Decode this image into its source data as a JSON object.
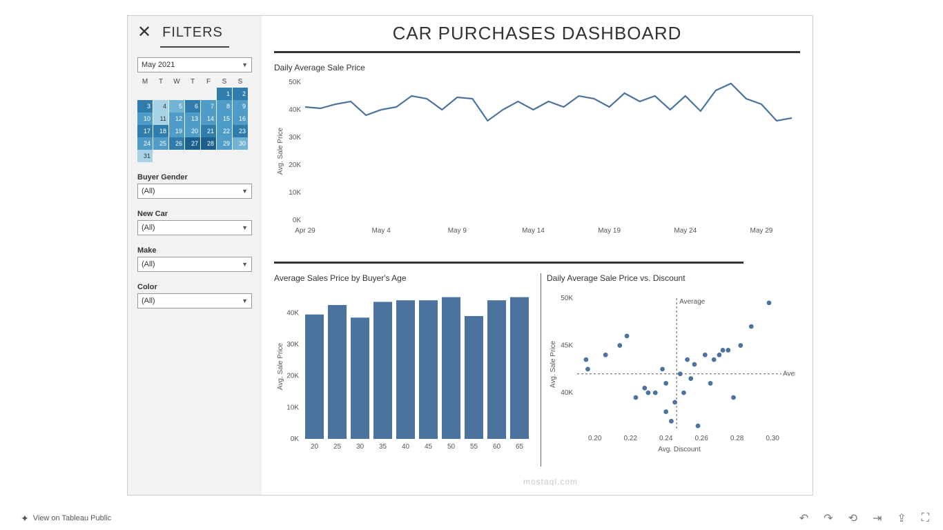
{
  "filters": {
    "title": "FILTERS",
    "month_dropdown": "May 2021",
    "weekdays": [
      "M",
      "T",
      "W",
      "T",
      "F",
      "S",
      "S"
    ],
    "calendar_rows": [
      [
        null,
        null,
        null,
        null,
        null,
        {
          "d": 1,
          "c": 4
        },
        {
          "d": 2,
          "c": 4
        }
      ],
      [
        {
          "d": 3,
          "c": 4
        },
        {
          "d": 4,
          "c": 1
        },
        {
          "d": 5,
          "c": 2
        },
        {
          "d": 6,
          "c": 4
        },
        {
          "d": 7,
          "c": 3
        },
        {
          "d": 8,
          "c": 3
        },
        {
          "d": 9,
          "c": 3
        }
      ],
      [
        {
          "d": 10,
          "c": 3
        },
        {
          "d": 11,
          "c": 1
        },
        {
          "d": 12,
          "c": 3
        },
        {
          "d": 13,
          "c": 3
        },
        {
          "d": 14,
          "c": 3
        },
        {
          "d": 15,
          "c": 3
        },
        {
          "d": 16,
          "c": 3
        }
      ],
      [
        {
          "d": 17,
          "c": 4
        },
        {
          "d": 18,
          "c": 4
        },
        {
          "d": 19,
          "c": 3
        },
        {
          "d": 20,
          "c": 3
        },
        {
          "d": 21,
          "c": 4
        },
        {
          "d": 22,
          "c": 3
        },
        {
          "d": 23,
          "c": 4
        }
      ],
      [
        {
          "d": 24,
          "c": 3
        },
        {
          "d": 25,
          "c": 3
        },
        {
          "d": 26,
          "c": 4
        },
        {
          "d": 27,
          "c": 5
        },
        {
          "d": 28,
          "c": 5
        },
        {
          "d": 29,
          "c": 3
        },
        {
          "d": 30,
          "c": 2
        }
      ],
      [
        {
          "d": 31,
          "c": 1
        },
        null,
        null,
        null,
        null,
        null,
        null
      ]
    ],
    "gender": {
      "label": "Buyer Gender",
      "value": "(All)"
    },
    "newcar": {
      "label": "New Car",
      "value": "(All)"
    },
    "make": {
      "label": "Make",
      "value": "(All)"
    },
    "color": {
      "label": "Color",
      "value": "(All)"
    }
  },
  "dashboard_title": "CAR PURCHASES DASHBOARD",
  "chart1": {
    "title": "Daily Average Sale Price",
    "ylabel": "Avg. Sale Price",
    "y_ticks": [
      "0K",
      "10K",
      "20K",
      "30K",
      "40K",
      "50K"
    ],
    "x_ticks": [
      "Apr 29",
      "May 4",
      "May 9",
      "May 14",
      "May 19",
      "May 24",
      "May 29"
    ]
  },
  "chart2": {
    "title": "Average Sales Price by Buyer's Age",
    "ylabel": "Avg. Sale Price",
    "y_ticks": [
      "0K",
      "10K",
      "20K",
      "30K",
      "40K"
    ],
    "x_ticks": [
      "20",
      "25",
      "30",
      "35",
      "40",
      "45",
      "50",
      "55",
      "60",
      "65"
    ]
  },
  "chart3": {
    "title": "Daily Average Sale Price vs. Discount",
    "ylabel": "Avg. Sale Price",
    "xlabel": "Avg. Discount",
    "ref_label": "Average",
    "y_ticks": [
      "40K",
      "45K",
      "50K"
    ],
    "x_ticks": [
      "0.20",
      "0.22",
      "0.24",
      "0.26",
      "0.28",
      "0.30"
    ]
  },
  "footer": {
    "view_label": "View on Tableau Public"
  },
  "watermark": "mostaql.com",
  "chart_data": [
    {
      "type": "line",
      "title": "Daily Average Sale Price",
      "xlabel": "",
      "ylabel": "Avg. Sale Price",
      "ylim": [
        0,
        50
      ],
      "x": [
        "Apr 29",
        "Apr 30",
        "May 1",
        "May 2",
        "May 3",
        "May 4",
        "May 5",
        "May 6",
        "May 7",
        "May 8",
        "May 9",
        "May 10",
        "May 11",
        "May 12",
        "May 13",
        "May 14",
        "May 15",
        "May 16",
        "May 17",
        "May 18",
        "May 19",
        "May 20",
        "May 21",
        "May 22",
        "May 23",
        "May 24",
        "May 25",
        "May 26",
        "May 27",
        "May 28",
        "May 29",
        "May 30",
        "May 31"
      ],
      "values": [
        41,
        40.5,
        42,
        43,
        38,
        40,
        41,
        45,
        44,
        40,
        44.5,
        44,
        36,
        40,
        43,
        40,
        43,
        41,
        45,
        44,
        41,
        46,
        43,
        45,
        40,
        45,
        39.5,
        47,
        49.5,
        44,
        42,
        36,
        37
      ],
      "value_unit": "K"
    },
    {
      "type": "bar",
      "title": "Average Sales Price by Buyer's Age",
      "xlabel": "",
      "ylabel": "Avg. Sale Price",
      "ylim": [
        0,
        46
      ],
      "categories": [
        "20",
        "25",
        "30",
        "35",
        "40",
        "45",
        "50",
        "55",
        "60",
        "65"
      ],
      "values": [
        39.5,
        42.5,
        38.5,
        43.5,
        44,
        44,
        45,
        39,
        44,
        45
      ],
      "value_unit": "K"
    },
    {
      "type": "scatter",
      "title": "Daily Average Sale Price vs. Discount",
      "xlabel": "Avg. Discount",
      "ylabel": "Avg. Sale Price",
      "xlim": [
        0.19,
        0.305
      ],
      "ylim": [
        36,
        50
      ],
      "reference_lines": {
        "x": 0.246,
        "y": 42,
        "label": "Average"
      },
      "points": [
        {
          "x": 0.195,
          "y": 43.5
        },
        {
          "x": 0.196,
          "y": 42.5
        },
        {
          "x": 0.206,
          "y": 44
        },
        {
          "x": 0.214,
          "y": 45
        },
        {
          "x": 0.218,
          "y": 46
        },
        {
          "x": 0.223,
          "y": 39.5
        },
        {
          "x": 0.228,
          "y": 40.5
        },
        {
          "x": 0.23,
          "y": 40
        },
        {
          "x": 0.234,
          "y": 40
        },
        {
          "x": 0.238,
          "y": 42.5
        },
        {
          "x": 0.24,
          "y": 41
        },
        {
          "x": 0.24,
          "y": 38
        },
        {
          "x": 0.243,
          "y": 37
        },
        {
          "x": 0.245,
          "y": 39
        },
        {
          "x": 0.248,
          "y": 42
        },
        {
          "x": 0.25,
          "y": 40
        },
        {
          "x": 0.252,
          "y": 43.5
        },
        {
          "x": 0.254,
          "y": 41.5
        },
        {
          "x": 0.256,
          "y": 43
        },
        {
          "x": 0.258,
          "y": 36.5
        },
        {
          "x": 0.262,
          "y": 44
        },
        {
          "x": 0.265,
          "y": 41
        },
        {
          "x": 0.267,
          "y": 43.5
        },
        {
          "x": 0.27,
          "y": 44
        },
        {
          "x": 0.272,
          "y": 44.5
        },
        {
          "x": 0.275,
          "y": 44.5
        },
        {
          "x": 0.278,
          "y": 39.5
        },
        {
          "x": 0.282,
          "y": 45
        },
        {
          "x": 0.288,
          "y": 47
        },
        {
          "x": 0.298,
          "y": 49.5
        }
      ],
      "value_unit": "K"
    }
  ]
}
